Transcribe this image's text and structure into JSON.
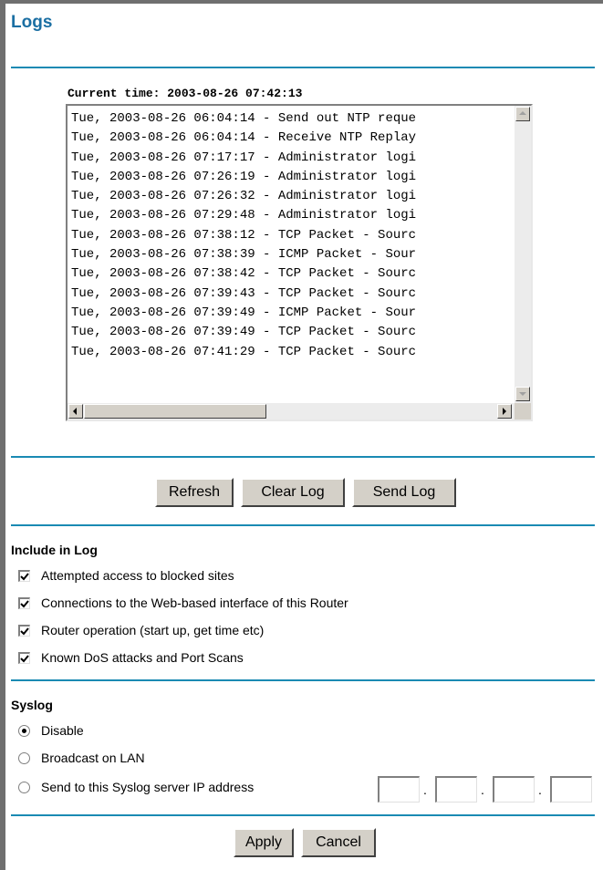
{
  "page": {
    "title": "Logs"
  },
  "log": {
    "current_time": "Current time: 2003-08-26 07:42:13",
    "entries": [
      "Tue, 2003-08-26 06:04:14 - Send out NTP reque",
      "Tue, 2003-08-26 06:04:14 - Receive NTP Replay",
      "Tue, 2003-08-26 07:17:17 - Administrator logi",
      "Tue, 2003-08-26 07:26:19 - Administrator logi",
      "Tue, 2003-08-26 07:26:32 - Administrator logi",
      "Tue, 2003-08-26 07:29:48 - Administrator logi",
      "Tue, 2003-08-26 07:38:12 - TCP Packet - Sourc",
      "Tue, 2003-08-26 07:38:39 - ICMP Packet - Sour",
      "Tue, 2003-08-26 07:38:42 - TCP Packet - Sourc",
      "Tue, 2003-08-26 07:39:43 - TCP Packet - Sourc",
      "Tue, 2003-08-26 07:39:49 - ICMP Packet - Sour",
      "Tue, 2003-08-26 07:39:49 - TCP Packet - Sourc",
      "Tue, 2003-08-26 07:41:29 - TCP Packet - Sourc"
    ]
  },
  "log_buttons": {
    "refresh": "Refresh",
    "clear": "Clear Log",
    "send": "Send Log"
  },
  "include": {
    "title": "Include in Log",
    "options": [
      {
        "label": "Attempted access to blocked sites",
        "checked": true
      },
      {
        "label": "Connections to the Web-based interface of this Router",
        "checked": true
      },
      {
        "label": "Router operation (start up, get time etc)",
        "checked": true
      },
      {
        "label": "Known DoS attacks and Port Scans",
        "checked": true
      }
    ]
  },
  "syslog": {
    "title": "Syslog",
    "options": [
      {
        "label": "Disable",
        "selected": true
      },
      {
        "label": "Broadcast on LAN",
        "selected": false
      },
      {
        "label": "Send to this Syslog server IP address",
        "selected": false
      }
    ],
    "ip_octets": [
      "",
      "",
      "",
      ""
    ],
    "ip_separator": "."
  },
  "footer": {
    "apply": "Apply",
    "cancel": "Cancel"
  },
  "colors": {
    "accent": "#1a8ab3",
    "title": "#1b6fa3",
    "button_face": "#d4d0c8"
  }
}
